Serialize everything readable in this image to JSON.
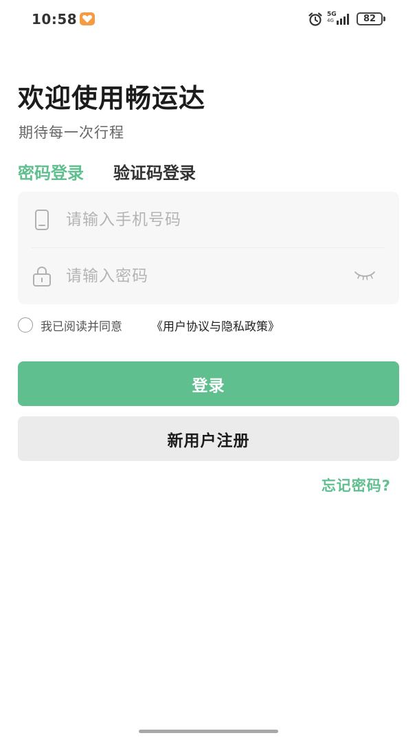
{
  "status_bar": {
    "time": "10:58",
    "network": "5G",
    "network_sub": "4G",
    "battery": "82",
    "icons": [
      "app-notification-icon",
      "alarm-icon",
      "signal-icon",
      "battery-icon"
    ]
  },
  "header": {
    "title": "欢迎使用畅运达",
    "subtitle": "期待每一次行程"
  },
  "tabs": {
    "password_login": "密码登录",
    "code_login": "验证码登录",
    "active": "password_login"
  },
  "form": {
    "phone_placeholder": "请输入手机号码",
    "phone_value": "",
    "password_placeholder": "请输入密码",
    "password_value": "",
    "icons": [
      "phone-icon",
      "lock-icon",
      "eye-closed-icon"
    ]
  },
  "agreement": {
    "text": "我已阅读并同意",
    "link": "《用户协议与隐私政策》",
    "checked": false
  },
  "buttons": {
    "login": "登录",
    "register": "新用户注册",
    "forgot_password": "忘记密码?"
  },
  "colors": {
    "accent": "#5fbf8f",
    "background": "#ffffff",
    "card": "#f7f7f7",
    "secondary_button": "#ebebeb"
  }
}
